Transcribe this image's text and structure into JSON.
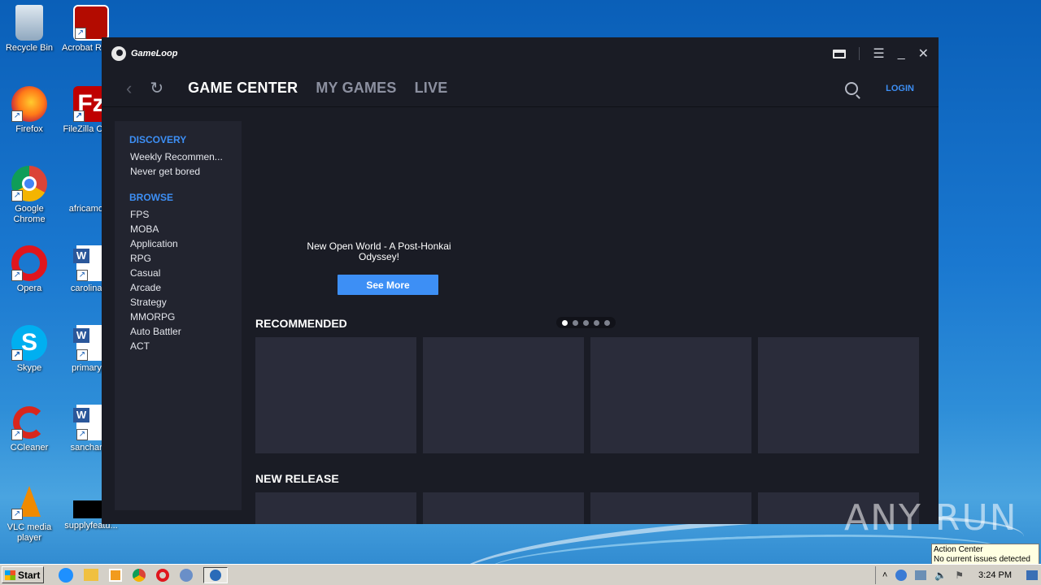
{
  "desktop": {
    "icons": [
      {
        "label": "Recycle Bin",
        "icon": "recycle-bin-icon"
      },
      {
        "label": "Acrobat Reader DC",
        "icon": "acrobat-icon"
      },
      {
        "label": "Firefox",
        "icon": "firefox-icon"
      },
      {
        "label": "FileZilla Client",
        "icon": "filezilla-icon"
      },
      {
        "label": "Google Chrome",
        "icon": "chrome-icon"
      },
      {
        "label": "africamode",
        "icon": "file-icon"
      },
      {
        "label": "Opera",
        "icon": "opera-icon"
      },
      {
        "label": "carolinaus",
        "icon": "word-doc-icon"
      },
      {
        "label": "Skype",
        "icon": "skype-icon"
      },
      {
        "label": "primaryfilt",
        "icon": "word-doc-icon"
      },
      {
        "label": "CCleaner",
        "icon": "ccleaner-icon"
      },
      {
        "label": "sancharac",
        "icon": "word-doc-icon"
      },
      {
        "label": "VLC media player",
        "icon": "vlc-icon"
      },
      {
        "label": "supplyfeatu...",
        "icon": "file-icon"
      }
    ]
  },
  "app": {
    "brand": "GameLoop",
    "nav": {
      "tabs": [
        "GAME CENTER",
        "MY GAMES",
        "LIVE"
      ],
      "login": "LOGIN"
    },
    "sidebar": {
      "discovery_heading": "DISCOVERY",
      "discovery_items": [
        "Weekly Recommen...",
        "Never get bored"
      ],
      "browse_heading": "BROWSE",
      "browse_items": [
        "FPS",
        "MOBA",
        "Application",
        "RPG",
        "Casual",
        "Arcade",
        "Strategy",
        "MMORPG",
        "Auto Battler",
        "ACT"
      ]
    },
    "banner": {
      "title": "New Open World - A Post-Honkai Odyssey!",
      "button": "See More",
      "carousel_count": 5,
      "carousel_active": 1
    },
    "sections": {
      "recommended": "RECOMMENDED",
      "new_release": "NEW RELEASE"
    },
    "colors": {
      "accent": "#3d8ff5",
      "background": "#1a1c25",
      "tile": "#2a2c3a"
    }
  },
  "taskbar": {
    "start": "Start",
    "time": "3:24 PM",
    "tooltip_title": "Action Center",
    "tooltip_body": "No current issues detected"
  },
  "watermark": "ANY RUN"
}
